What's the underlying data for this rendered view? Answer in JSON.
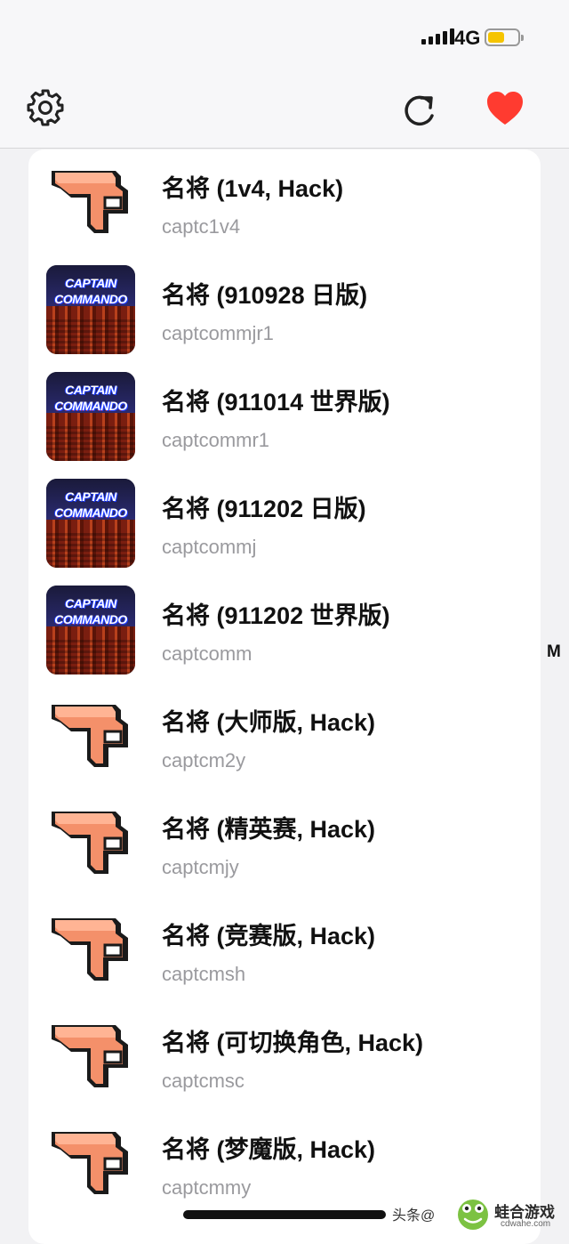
{
  "status_bar": {
    "network": "4G",
    "battery_level": 0.55,
    "battery_color": "#f5c400"
  },
  "toolbar": {
    "settings_icon": "gear-icon",
    "refresh_icon": "refresh-icon",
    "favorite_icon": "heart-icon",
    "accent_color": "#ff3b30"
  },
  "games": [
    {
      "title": "名将 (1v4, Hack)",
      "rom": "captc1v4",
      "icon": "placeholder-logo-icon"
    },
    {
      "title": "名将 (910928 日版)",
      "rom": "captcommjr1",
      "icon": "captain-commando-icon"
    },
    {
      "title": "名将 (911014 世界版)",
      "rom": "captcommr1",
      "icon": "captain-commando-icon"
    },
    {
      "title": "名将 (911202 日版)",
      "rom": "captcommj",
      "icon": "captain-commando-icon"
    },
    {
      "title": "名将 (911202 世界版)",
      "rom": "captcomm",
      "icon": "captain-commando-icon"
    },
    {
      "title": "名将 (大师版, Hack)",
      "rom": "captcm2y",
      "icon": "placeholder-logo-icon"
    },
    {
      "title": "名将 (精英赛, Hack)",
      "rom": "captcmjy",
      "icon": "placeholder-logo-icon"
    },
    {
      "title": "名将 (竞赛版, Hack)",
      "rom": "captcmsh",
      "icon": "placeholder-logo-icon"
    },
    {
      "title": "名将 (可切换角色, Hack)",
      "rom": "captcmsc",
      "icon": "placeholder-logo-icon"
    },
    {
      "title": "名将 (梦魔版, Hack)",
      "rom": "captcmmy",
      "icon": "placeholder-logo-icon"
    }
  ],
  "captain_commando_art": {
    "line1": "CAPTAIN",
    "line2": "COMMANDO"
  },
  "side_index": "M",
  "watermark": {
    "source_text": "头条@",
    "brand": "蛙合游戏",
    "url": "cdwahe.com"
  }
}
